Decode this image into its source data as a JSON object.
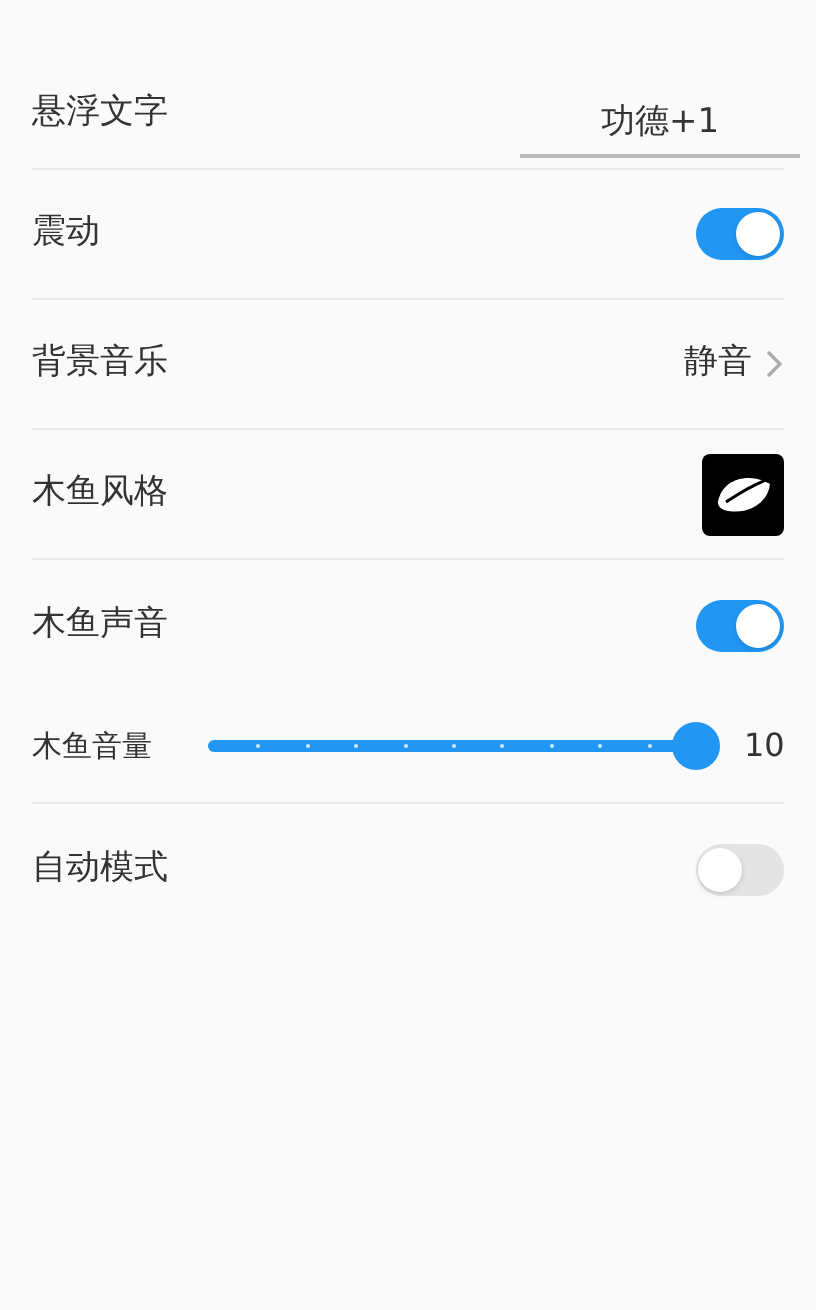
{
  "settings": [
    {
      "kind": "text",
      "label": "悬浮文字",
      "value": "功德+1"
    },
    {
      "kind": "toggle",
      "label": "震动",
      "on": true
    },
    {
      "kind": "link",
      "label": "背景音乐",
      "value": "静音"
    },
    {
      "kind": "style",
      "label": "木鱼风格"
    },
    {
      "kind": "toggle",
      "label": "木鱼声音",
      "on": true
    },
    {
      "kind": "slider",
      "label": "木鱼音量",
      "level": 1,
      "reading": "10"
    },
    {
      "kind": "toggle",
      "label": "自动模式",
      "on": false
    }
  ]
}
